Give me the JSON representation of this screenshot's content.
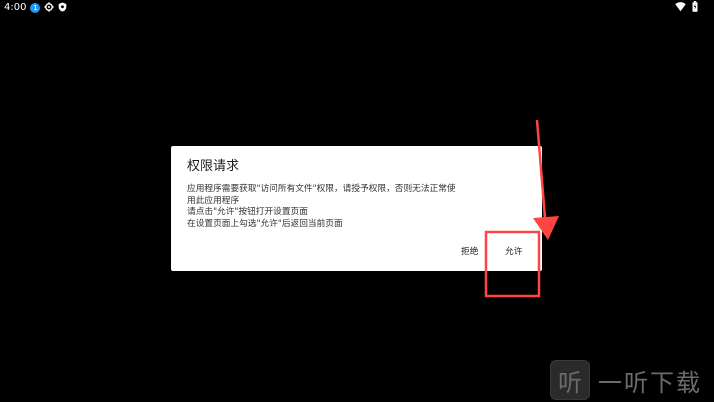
{
  "status_bar": {
    "time": "4:00",
    "notification_badge": "1"
  },
  "dialog": {
    "title": "权限请求",
    "message_lines": [
      "应用程序需要获取\"访问所有文件\"权限，请授予权限，否则无法正常使",
      "用此应用程序",
      "请点击\"允许\"按钮打开设置页面",
      "在设置页面上勾选\"允许\"后返回当前页面"
    ],
    "deny_label": "拒绝",
    "allow_label": "允许"
  },
  "annotation": {
    "color": "#ff4444"
  },
  "watermark": {
    "logo_char": "听",
    "text": "一听下载"
  },
  "colors": {
    "background": "#000000",
    "dialog_bg": "#ffffff",
    "accent_blue": "#2196f3"
  }
}
